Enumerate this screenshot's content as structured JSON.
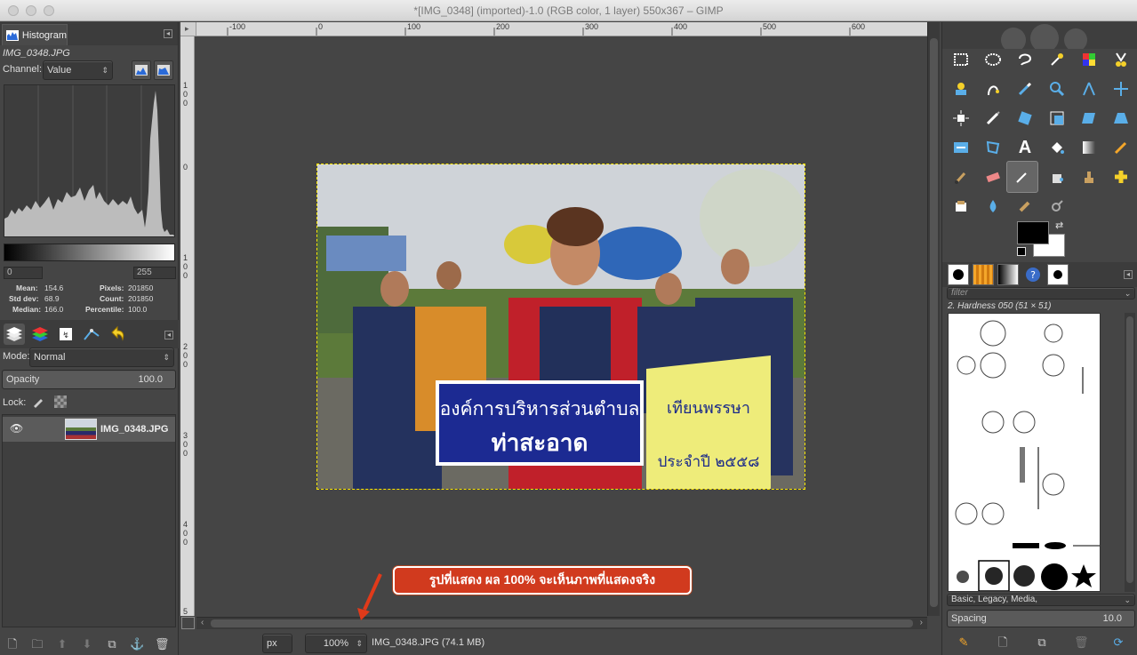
{
  "window": {
    "title": "*[IMG_0348] (imported)-1.0 (RGB color, 1 layer) 550x367 – GIMP"
  },
  "histogram": {
    "tab_label": "Histogram",
    "image_name": "IMG_0348.JPG",
    "channel_label": "Channel:",
    "channel_value": "Value",
    "range_low": "0",
    "range_high": "255",
    "stats": {
      "mean_label": "Mean:",
      "mean": "154.6",
      "std_label": "Std dev:",
      "std": "68.9",
      "median_label": "Median:",
      "median": "166.0",
      "pixels_label": "Pixels:",
      "pixels": "201850",
      "count_label": "Count:",
      "count": "201850",
      "percentile_label": "Percentile:",
      "percentile": "100.0"
    }
  },
  "layers": {
    "mode_label": "Mode:",
    "mode_value": "Normal",
    "opacity_label": "Opacity",
    "opacity_value": "100.0",
    "lock_label": "Lock:",
    "layer_name": "IMG_0348.JPG"
  },
  "ruler": {
    "h_ticks": [
      "-100",
      "0",
      "100",
      "200",
      "300",
      "400",
      "500",
      "600"
    ],
    "v_ticks": [
      "1\n0\n0",
      "0",
      "1\n0\n0",
      "2\n0\n0",
      "3\n0\n0",
      "4\n0\n0",
      "5"
    ]
  },
  "status": {
    "unit": "px",
    "zoom": "100%",
    "info": "IMG_0348.JPG (74.1 MB)"
  },
  "annotation": "รูปที่แสดง ผล 100% จะเห็นภาพที่แสดงจริง",
  "image_text": {
    "sign_line1": "องค์การบริหารส่วนตำบล",
    "sign_line2": "ท่าสะอาด"
  },
  "brushes": {
    "filter_placeholder": "filter",
    "current": "2. Hardness 050 (51 × 51)",
    "tags": "Basic, Legacy, Media,",
    "spacing_label": "Spacing",
    "spacing_value": "10.0"
  },
  "colors": {
    "accent": "#5aaee8",
    "annotation": "#d13a1e",
    "selection": "#ffea00"
  }
}
